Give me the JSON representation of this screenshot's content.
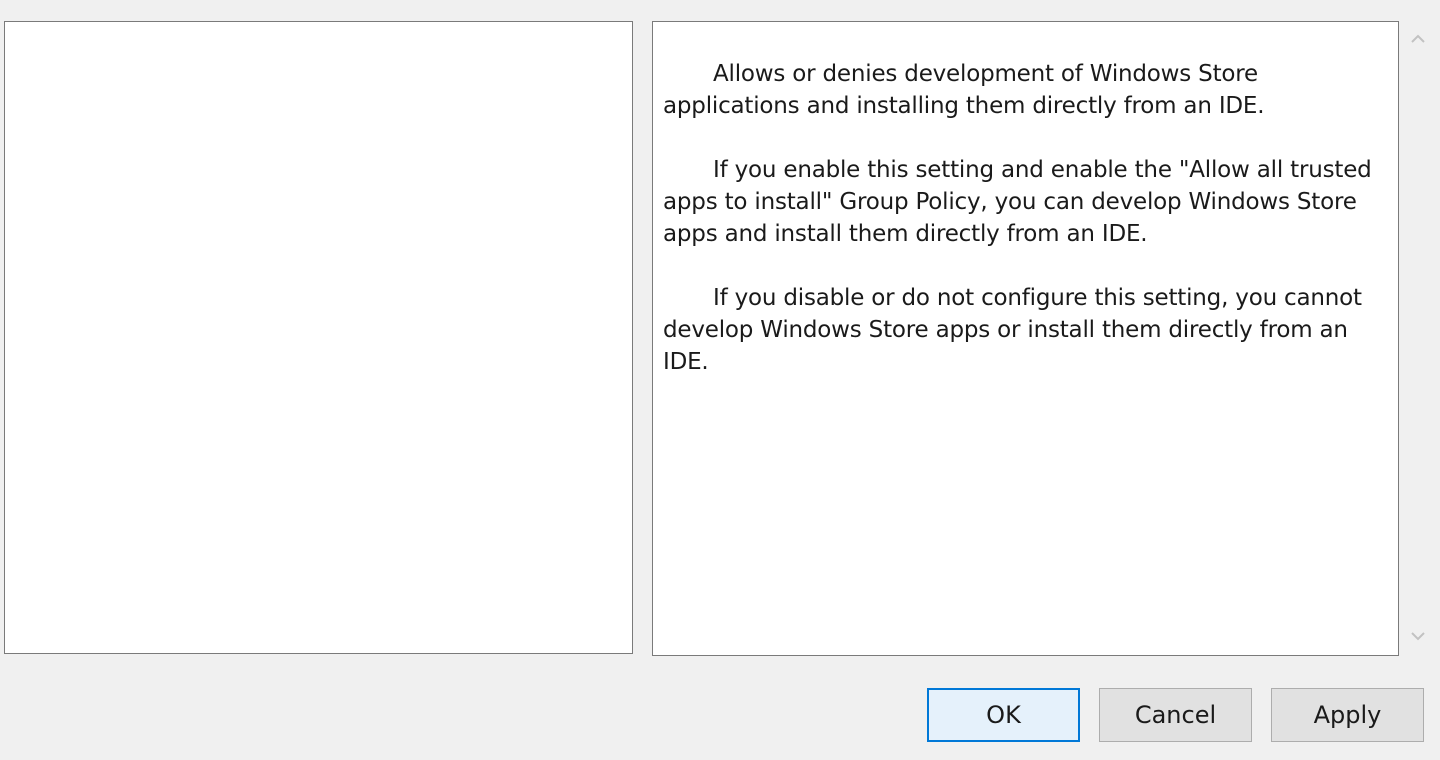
{
  "help": {
    "paragraphs": [
      "Allows or denies development of Windows Store applications and installing them directly from an IDE.",
      "If you enable this setting and enable the \"Allow all trusted apps to install\" Group Policy, you can develop Windows Store apps and install them directly from an IDE.",
      "If you disable or do not configure this setting, you cannot develop Windows Store apps or install them directly from an IDE."
    ]
  },
  "scrollbar": {
    "up_icon": "chevron-up-icon",
    "down_icon": "chevron-down-icon"
  },
  "buttons": {
    "ok": "OK",
    "cancel": "Cancel",
    "apply": "Apply"
  },
  "colors": {
    "window_bg": "#f0f0f0",
    "pane_bg": "#ffffff",
    "default_button_border": "#0078d7"
  }
}
